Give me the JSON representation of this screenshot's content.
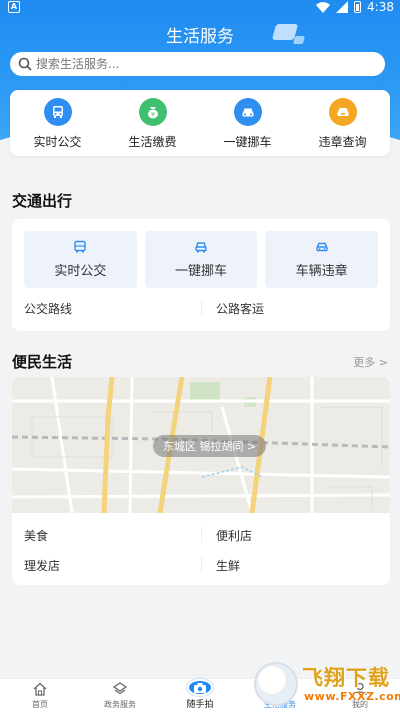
{
  "status_bar": {
    "left_badge": "A",
    "time": "4:38"
  },
  "header": {
    "title": "生活服务"
  },
  "search": {
    "placeholder": "搜索生活服务..."
  },
  "quick_actions": [
    {
      "label": "实时公交",
      "icon": "bus-icon",
      "color": "#2f8ff1"
    },
    {
      "label": "生活缴费",
      "icon": "money-bag-icon",
      "color": "#3fbf6f"
    },
    {
      "label": "一键挪车",
      "icon": "car-icon",
      "color": "#2f8ff1"
    },
    {
      "label": "违章查询",
      "icon": "car-alert-icon",
      "color": "#f5a623"
    }
  ],
  "traffic": {
    "title": "交通出行",
    "tiles": [
      {
        "label": "实时公交",
        "icon": "bus-icon"
      },
      {
        "label": "一键挪车",
        "icon": "car-icon"
      },
      {
        "label": "车辆违章",
        "icon": "car-front-icon"
      }
    ],
    "links": [
      "公交路线",
      "公路客运"
    ]
  },
  "life": {
    "title": "便民生活",
    "more": "更多 >",
    "map_location": "东城区 锡拉胡同 >",
    "links": [
      "美食",
      "便利店",
      "理发店",
      "生鲜"
    ]
  },
  "tabbar": {
    "tabs": [
      {
        "label": "首页",
        "icon": "home-icon"
      },
      {
        "label": "政务服务",
        "icon": "government-icon"
      },
      {
        "label": "随手拍",
        "icon": "camera-icon"
      },
      {
        "label": "生活服务",
        "icon": "life-service-icon",
        "active": true
      },
      {
        "label": "我的",
        "icon": "user-icon"
      }
    ]
  },
  "watermark": {
    "brand": "飞翔下载",
    "url": "www.FXXZ.com"
  },
  "colors": {
    "primary": "#1f8bf0",
    "tile_bg": "#eef3fb",
    "page_bg": "#f2f3f5"
  }
}
